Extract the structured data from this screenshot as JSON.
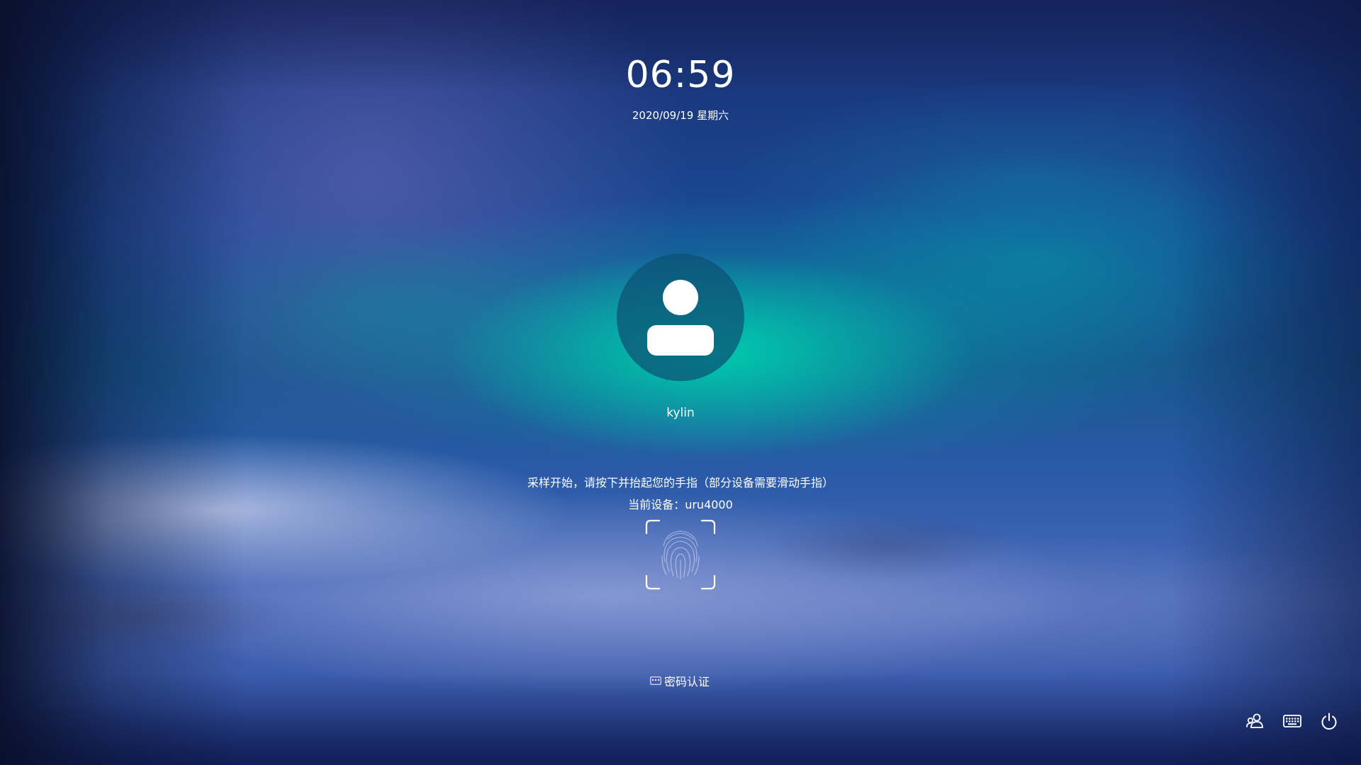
{
  "clock": {
    "time": "06:59",
    "date": "2020/09/19 星期六"
  },
  "user": {
    "name": "kylin",
    "avatar_icon": "user-icon"
  },
  "fingerprint": {
    "prompt": "采样开始，请按下并抬起您的手指（部分设备需要滑动手指）",
    "device_line": "当前设备：uru4000",
    "icon": "fingerprint-icon"
  },
  "auth_switch": {
    "label": "密码认证",
    "icon": "keyboard-icon"
  },
  "tray": [
    {
      "name": "switch-user",
      "icon": "switch-user-icon"
    },
    {
      "name": "virtual-keyboard",
      "icon": "keyboard-icon"
    },
    {
      "name": "power",
      "icon": "power-icon"
    }
  ],
  "colors": {
    "text": "#ffffff",
    "avatar_bg": "#0c5073",
    "accent_aurora": "#00d2af"
  }
}
